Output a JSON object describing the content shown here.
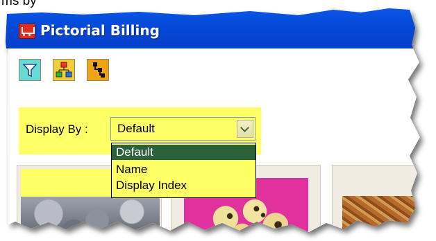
{
  "caption": "ms by",
  "window": {
    "title": "Pictorial Billing",
    "icon": "shopping-cart-icon"
  },
  "toolbar": {
    "buttons": [
      {
        "icon": "filter-icon",
        "color": "#69d9d3"
      },
      {
        "icon": "hierarchy-icon",
        "color": "#f4cd3c"
      },
      {
        "icon": "tree-view-icon",
        "color": "#efa416"
      }
    ]
  },
  "display_by": {
    "label": "Display By :",
    "selected": "Default",
    "options": [
      "Default",
      "Name",
      "Display Index"
    ],
    "highlight_color": "#ffff66",
    "selection_color": "#2c623b"
  },
  "colors": {
    "titlebar": "#0548d8",
    "panel": "#ffff66"
  }
}
